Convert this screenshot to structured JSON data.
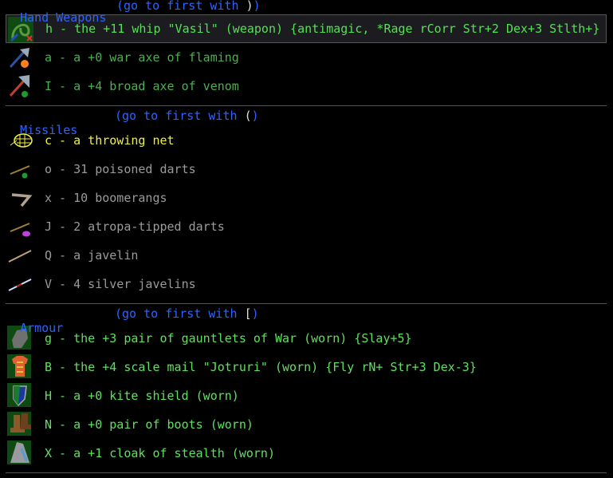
{
  "sections": [
    {
      "title": "Hand Weapons",
      "link": "(go to first with ",
      "key": ")",
      "link_end": ")",
      "items": [
        {
          "text": "h - the +11 whip \"Vasil\" (weapon) {antimagic, *Rage rCorr Str+2 Dex+3 Stlth+}",
          "icon": "whip-icon",
          "selected": true
        },
        {
          "text": "a - a +0 war axe of flaming",
          "icon": "war-axe-icon"
        },
        {
          "text": "I - a +4 broad axe of venom",
          "icon": "broad-axe-icon"
        }
      ]
    },
    {
      "title": "Missiles",
      "link": "(go to first with ",
      "key": "(",
      "link_end": ")",
      "items": [
        {
          "text": "c - a throwing net",
          "icon": "net-icon"
        },
        {
          "text": "o - 31 poisoned darts",
          "icon": "dart-icon"
        },
        {
          "text": "x - 10 boomerangs",
          "icon": "boomerang-icon"
        },
        {
          "text": "J - 2 atropa-tipped darts",
          "icon": "dart-icon"
        },
        {
          "text": "Q - a javelin",
          "icon": "javelin-icon"
        },
        {
          "text": "V - 4 silver javelins",
          "icon": "javelin-icon"
        }
      ]
    },
    {
      "title": "Armour",
      "link": "(go to first with ",
      "key": "[",
      "link_end": ")",
      "items": [
        {
          "text": "g - the +3 pair of gauntlets of War (worn) {Slay+5}",
          "icon": "gauntlets-icon"
        },
        {
          "text": "B - the +4 scale mail \"Jotruri\" (worn) {Fly rN+ Str+3 Dex-3}",
          "icon": "scale-mail-icon"
        },
        {
          "text": "H - a +0 kite shield (worn)",
          "icon": "shield-icon"
        },
        {
          "text": "N - a +0 pair of boots (worn)",
          "icon": "boots-icon"
        },
        {
          "text": "X - a +1 cloak of stealth (worn)",
          "icon": "cloak-icon"
        }
      ]
    }
  ],
  "colors": {
    "header": "#2f63ff",
    "selected_bg": "#1c1c20",
    "artefact": "#55e055",
    "ego": "#4caf50",
    "plain": "#9a9a9a",
    "net": "#f0f040",
    "worn": "#5fe05f"
  }
}
